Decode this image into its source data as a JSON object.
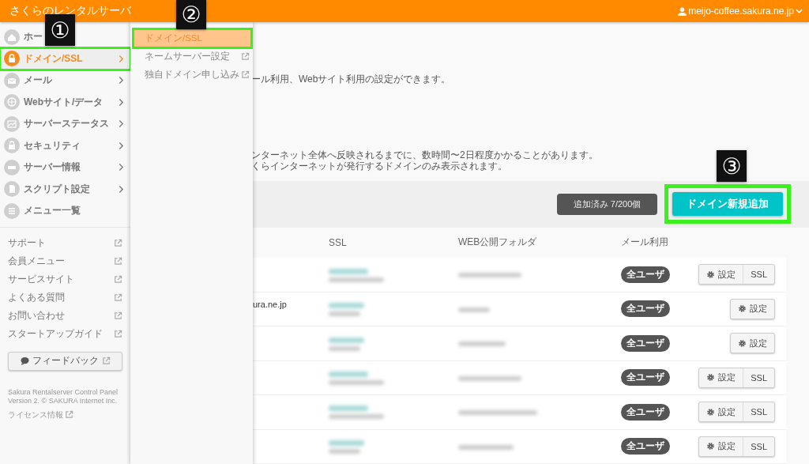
{
  "header": {
    "title": "さくらのレンタルサーバ",
    "account": "meijo-coffee.sakura.ne.jp"
  },
  "sidebar": {
    "items": [
      {
        "kind": "home",
        "label": "ホー",
        "selected": false,
        "has_submenu": false,
        "annotated": false
      },
      {
        "kind": "domain",
        "label": "ドメイン/SSL",
        "selected": true,
        "has_submenu": true,
        "annotated": true
      },
      {
        "kind": "mail",
        "label": "メール",
        "selected": false,
        "has_submenu": true,
        "annotated": false
      },
      {
        "kind": "web",
        "label": "Webサイト/データ",
        "selected": false,
        "has_submenu": true,
        "annotated": false
      },
      {
        "kind": "status",
        "label": "サーバーステータス",
        "selected": false,
        "has_submenu": true,
        "annotated": false
      },
      {
        "kind": "security",
        "label": "セキュリティ",
        "selected": false,
        "has_submenu": true,
        "annotated": false
      },
      {
        "kind": "server",
        "label": "サーバー情報",
        "selected": false,
        "has_submenu": true,
        "annotated": false
      },
      {
        "kind": "script",
        "label": "スクリプト設定",
        "selected": false,
        "has_submenu": true,
        "annotated": false
      },
      {
        "kind": "list",
        "label": "メニュー一覧",
        "selected": false,
        "has_submenu": false,
        "annotated": false
      }
    ],
    "links": [
      "サポート",
      "会員メニュー",
      "サービスサイト",
      "よくある質問",
      "お問い合わせ",
      "スタートアップガイド"
    ],
    "feedback": "フィードバック",
    "footer": [
      "Sakura Rentalserver Control Panel",
      "Version 2. © SAKURA Internet Inc."
    ],
    "license": "ライセンス情報"
  },
  "submenu": {
    "items": [
      {
        "label": "ドメイン/SSL",
        "selected": true,
        "external": false,
        "annotated": true
      },
      {
        "label": "ネームサーバー設定",
        "selected": false,
        "external": true,
        "annotated": false
      },
      {
        "label": "独自ドメイン申し込み",
        "selected": false,
        "external": true,
        "annotated": false
      }
    ]
  },
  "main": {
    "description": "ール利用、Webサイト利用の設定ができます。",
    "notes": [
      "ンターネット全体へ反映されるまでに、数時間〜2日程度かかることがあります。",
      "くらインターネットが発行するドメインのみ表示されます。"
    ],
    "count": "追加済み 7/200個",
    "add_button": {
      "label": "ドメイン新規追加",
      "annotated": true
    },
    "table": {
      "columns": [
        "SSL",
        "WEB公開フォルダ",
        "メール利用"
      ],
      "rows": [
        {
          "mail": "全ユーザ",
          "actions": [
            {
              "kind": "settings",
              "label": "設定"
            },
            {
              "kind": "ssl",
              "label": "SSL"
            }
          ]
        },
        {
          "domain": "ura.ne.jp",
          "mail": "全ユーザ",
          "actions": [
            {
              "kind": "settings",
              "label": "設定"
            }
          ]
        },
        {
          "mail": "全ユーザ",
          "actions": [
            {
              "kind": "settings",
              "label": "設定"
            }
          ]
        },
        {
          "mail": "全ユーザ",
          "actions": [
            {
              "kind": "settings",
              "label": "設定"
            },
            {
              "kind": "ssl",
              "label": "SSL"
            }
          ]
        },
        {
          "mail": "全ユーザ",
          "actions": [
            {
              "kind": "settings",
              "label": "設定"
            },
            {
              "kind": "ssl",
              "label": "SSL"
            }
          ]
        },
        {
          "mail": "全ユーザ",
          "actions": [
            {
              "kind": "settings",
              "label": "設定"
            },
            {
              "kind": "ssl",
              "label": "SSL"
            }
          ]
        }
      ]
    }
  },
  "annotations": [
    {
      "label": "①"
    },
    {
      "label": "②"
    },
    {
      "label": "③"
    }
  ]
}
